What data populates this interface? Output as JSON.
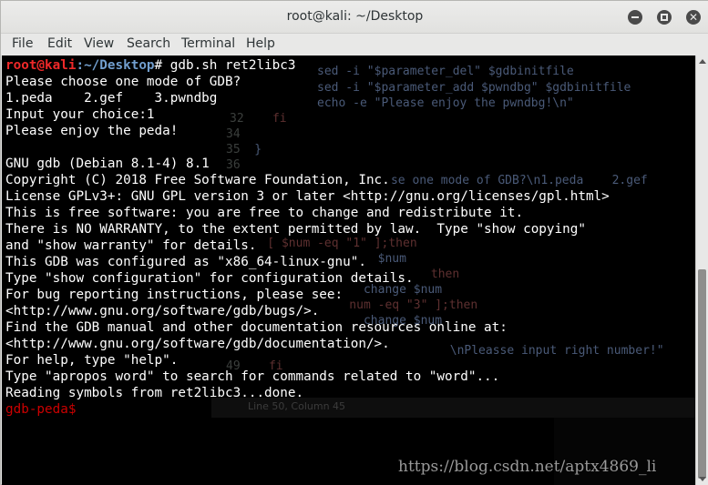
{
  "window": {
    "title": "root@kali: ~/Desktop"
  },
  "menu": {
    "items": [
      "File",
      "Edit",
      "View",
      "Search",
      "Terminal",
      "Help"
    ]
  },
  "prompt": {
    "user_host": "root@kali",
    "path": ":~/Desktop",
    "symbol": "# ",
    "command": "gdb.sh ret2libc3"
  },
  "output_lines": [
    "Please choose one mode of GDB?",
    "1.peda    2.gef    3.pwndbg",
    "Input your choice:1",
    "Please enjoy the peda!",
    "",
    "GNU gdb (Debian 8.1-4) 8.1",
    "Copyright (C) 2018 Free Software Foundation, Inc.",
    "License GPLv3+: GNU GPL version 3 or later <http://gnu.org/licenses/gpl.html>",
    "This is free software: you are free to change and redistribute it.",
    "There is NO WARRANTY, to the extent permitted by law.  Type \"show copying\"",
    "and \"show warranty\" for details.",
    "This GDB was configured as \"x86_64-linux-gnu\".",
    "Type \"show configuration\" for configuration details.",
    "For bug reporting instructions, please see:",
    "<http://www.gnu.org/software/gdb/bugs/>.",
    "Find the GDB manual and other documentation resources online at:",
    "<http://www.gnu.org/software/gdb/documentation/>.",
    "For help, type \"help\".",
    "Type \"apropos word\" to search for commands related to \"word\"...",
    "Reading symbols from ret2libc3...done."
  ],
  "gdb_prompt": "gdb-peda$",
  "background_editor": {
    "lines": [
      {
        "num": "",
        "text": "sed -i \"$parameter_del\" $gdbinitfile"
      },
      {
        "num": "",
        "text": "sed -i \"$parameter_add $pwndbg\" $gdbinitfile"
      },
      {
        "num": "",
        "text": "echo -e \"Please enjoy the pwndbg!\\n\""
      },
      {
        "num": "32",
        "text": "    fi"
      },
      {
        "num": "34",
        "text": ""
      },
      {
        "num": "35",
        "text": "  }"
      },
      {
        "num": "36",
        "text": ""
      },
      {
        "num": "",
        "text": "      se one mode of GDB?\\n1.peda    2.gef"
      },
      {
        "num": "",
        "text": "    [ $num -eq \"1\" ];then"
      },
      {
        "num": "",
        "text": "        $num"
      },
      {
        "num": "",
        "text": "                  then"
      },
      {
        "num": "",
        "text": "      change $num"
      },
      {
        "num": "",
        "text": "    num -eq \"3\" ];then"
      },
      {
        "num": "",
        "text": "      change $num"
      },
      {
        "num": "",
        "text": "             \\nPleasse input right number!\""
      },
      {
        "num": "49",
        "text": "    fi"
      }
    ],
    "status": "Line 50, Column 45"
  },
  "watermark": "https://blog.csdn.net/aptx4869_li"
}
